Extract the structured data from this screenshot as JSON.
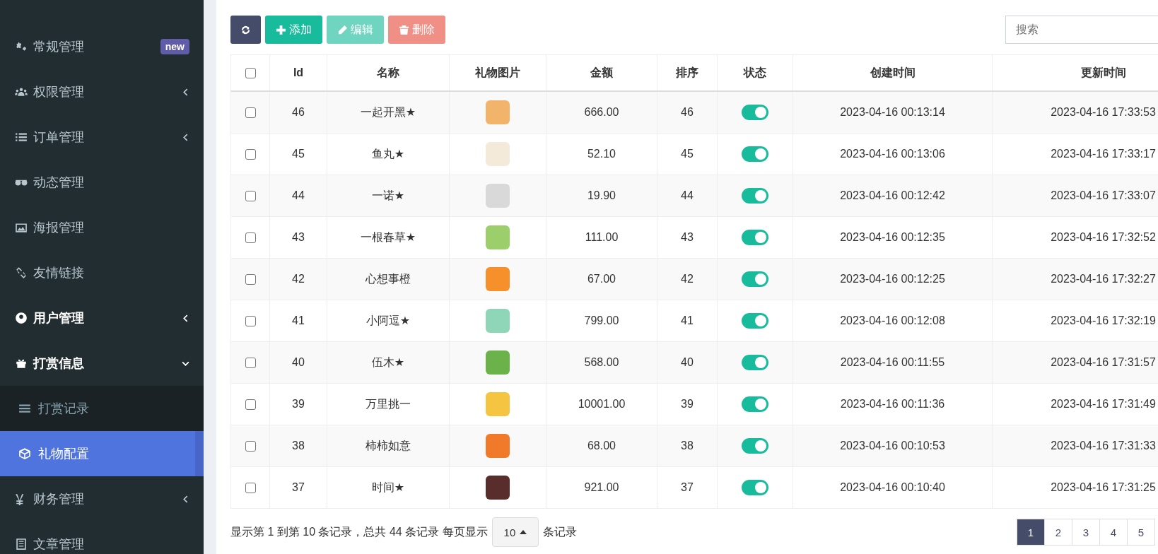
{
  "sidebar": {
    "items": [
      {
        "label": "常规管理",
        "expandable": false,
        "active": false,
        "selected": false,
        "badge": "new"
      },
      {
        "label": "权限管理",
        "expandable": true,
        "expanded": false,
        "active": false,
        "selected": false
      },
      {
        "label": "订单管理",
        "expandable": true,
        "expanded": false,
        "active": false,
        "selected": false
      },
      {
        "label": "动态管理",
        "expandable": false,
        "active": false,
        "selected": false
      },
      {
        "label": "海报管理",
        "expandable": false,
        "active": false,
        "selected": false
      },
      {
        "label": "友情链接",
        "expandable": false,
        "active": false,
        "selected": false
      },
      {
        "label": "用户管理",
        "expandable": true,
        "expanded": false,
        "active": true,
        "selected": false
      },
      {
        "label": "打赏信息",
        "expandable": true,
        "expanded": true,
        "active": true,
        "selected": false,
        "children": [
          {
            "label": "打赏记录",
            "selected": false
          },
          {
            "label": "礼物配置",
            "selected": true
          }
        ]
      },
      {
        "label": "财务管理",
        "expandable": true,
        "expanded": false,
        "active": false,
        "selected": false
      },
      {
        "label": "文章管理",
        "expandable": false,
        "active": false,
        "selected": false
      }
    ]
  },
  "toolbar": {
    "buttons": [
      {
        "kind": "refresh",
        "disabled": false
      },
      {
        "kind": "add",
        "label": "添加",
        "disabled": false
      },
      {
        "kind": "edit",
        "label": "编辑",
        "disabled": true
      },
      {
        "kind": "delete",
        "label": "删除",
        "disabled": true
      }
    ],
    "search": {
      "placeholder": "搜索"
    }
  },
  "table": {
    "columns": [
      "Id",
      "名称",
      "礼物图片",
      "金额",
      "排序",
      "状态",
      "创建时间",
      "更新时间"
    ],
    "header_checked": false,
    "rows": [
      {
        "checked": false,
        "id": "46",
        "name": "一起开黑★",
        "amount": "666.00",
        "sort": "46",
        "on": true,
        "created": "2023-04-16 00:13:14",
        "updated": "2023-04-16 17:33:53"
      },
      {
        "checked": false,
        "id": "45",
        "name": "鱼丸★",
        "amount": "52.10",
        "sort": "45",
        "on": true,
        "created": "2023-04-16 00:13:06",
        "updated": "2023-04-16 17:33:17"
      },
      {
        "checked": false,
        "id": "44",
        "name": "一诺★",
        "amount": "19.90",
        "sort": "44",
        "on": true,
        "created": "2023-04-16 00:12:42",
        "updated": "2023-04-16 17:33:07"
      },
      {
        "checked": false,
        "id": "43",
        "name": "一根春草★",
        "amount": "111.00",
        "sort": "43",
        "on": true,
        "created": "2023-04-16 00:12:35",
        "updated": "2023-04-16 17:32:52"
      },
      {
        "checked": false,
        "id": "42",
        "name": "心想事橙",
        "amount": "67.00",
        "sort": "42",
        "on": true,
        "created": "2023-04-16 00:12:25",
        "updated": "2023-04-16 17:32:27"
      },
      {
        "checked": false,
        "id": "41",
        "name": "小阿逗★",
        "amount": "799.00",
        "sort": "41",
        "on": true,
        "created": "2023-04-16 00:12:08",
        "updated": "2023-04-16 17:32:19"
      },
      {
        "checked": false,
        "id": "40",
        "name": "伍木★",
        "amount": "568.00",
        "sort": "40",
        "on": true,
        "created": "2023-04-16 00:11:55",
        "updated": "2023-04-16 17:31:57"
      },
      {
        "checked": false,
        "id": "39",
        "name": "万里挑一",
        "amount": "10001.00",
        "sort": "39",
        "on": true,
        "created": "2023-04-16 00:11:36",
        "updated": "2023-04-16 17:31:49"
      },
      {
        "checked": false,
        "id": "38",
        "name": "柿柿如意",
        "amount": "68.00",
        "sort": "38",
        "on": true,
        "created": "2023-04-16 00:10:53",
        "updated": "2023-04-16 17:31:33"
      },
      {
        "checked": false,
        "id": "37",
        "name": "时间★",
        "amount": "921.00",
        "sort": "37",
        "on": true,
        "created": "2023-04-16 00:10:40",
        "updated": "2023-04-16 17:31:25"
      }
    ]
  },
  "footer": {
    "summary": "显示第 1 到第 10 条记录，总共 44 条记录 每页显示",
    "page_size": "10",
    "suffix": "条记录",
    "pages": [
      {
        "label": "1",
        "selected": true
      },
      {
        "label": "2",
        "selected": false
      },
      {
        "label": "3",
        "selected": false
      },
      {
        "label": "4",
        "selected": false
      },
      {
        "label": "5",
        "selected": false
      }
    ]
  }
}
